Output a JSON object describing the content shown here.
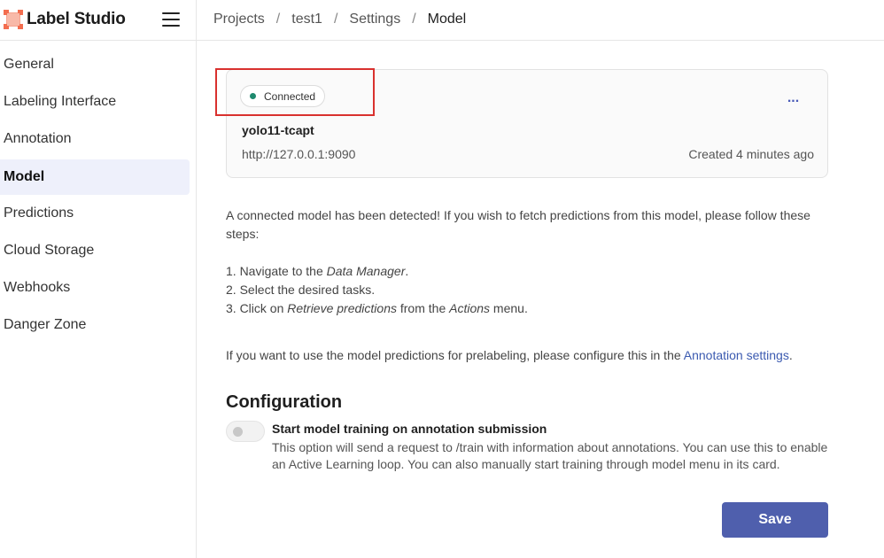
{
  "app": {
    "name": "Label Studio"
  },
  "breadcrumb": [
    "Projects",
    "test1",
    "Settings",
    "Model"
  ],
  "sidebar": {
    "items": [
      {
        "label": "General"
      },
      {
        "label": "Labeling Interface"
      },
      {
        "label": "Annotation"
      },
      {
        "label": "Model",
        "active": true
      },
      {
        "label": "Predictions"
      },
      {
        "label": "Cloud Storage"
      },
      {
        "label": "Webhooks"
      },
      {
        "label": "Danger Zone"
      }
    ]
  },
  "model_card": {
    "status": "Connected",
    "status_color": "#1e8a6e",
    "more_label": "...",
    "name": "yolo11-tcapt",
    "url": "http://127.0.0.1:9090",
    "created": "Created 4 minutes ago"
  },
  "info": {
    "intro": "A connected model has been detected! If you wish to fetch predictions from this model, please follow these steps:",
    "step1_prefix": "1. Navigate to the ",
    "step1_em": "Data Manager",
    "step1_suffix": ".",
    "step2": "2. Select the desired tasks.",
    "step3_prefix": "3. Click on ",
    "step3_em1": "Retrieve predictions",
    "step3_mid": " from the ",
    "step3_em2": "Actions",
    "step3_suffix": " menu.",
    "prelabel_text": "If you want to use the model predictions for prelabeling, please configure this in the ",
    "prelabel_link": "Annotation settings",
    "prelabel_suffix": "."
  },
  "configuration": {
    "title": "Configuration",
    "toggle_label": "Start model training on annotation submission",
    "toggle_desc": "This option will send a request to /train with information about annotations. You can use this to enable an Active Learning loop. You can also manually start training through model menu in its card.",
    "toggle_on": false
  },
  "save_label": "Save",
  "colors": {
    "accent": "#4f5fad",
    "link": "#3b5ab0",
    "logo": "#f36d4f",
    "highlight": "#d9312e"
  }
}
